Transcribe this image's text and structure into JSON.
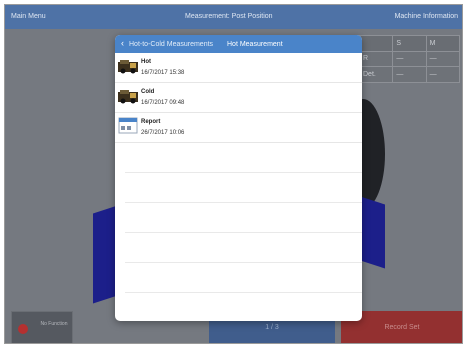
{
  "topbar": {
    "left": "Main Menu",
    "center": "Measurement: Post Position",
    "right": "Machine Information"
  },
  "grid": {
    "header": [
      "",
      "S",
      "M"
    ],
    "rows": [
      [
        "R",
        "—",
        "—"
      ],
      [
        "Det.",
        "—",
        "—"
      ]
    ]
  },
  "bottom": {
    "left_label": "No Function",
    "middle_label": "1 / 3",
    "right_label": "Record Set"
  },
  "dialog": {
    "back_label": "Hot-to-Cold Measurements",
    "title": "Hot Measurement",
    "items": [
      {
        "name": "Hot",
        "date": "16/7/2017 15:38",
        "icon": "vehicle-icon"
      },
      {
        "name": "Cold",
        "date": "16/7/2017 09:48",
        "icon": "vehicle-icon"
      },
      {
        "name": "Report",
        "date": "26/7/2017 10:06",
        "icon": "report-icon"
      }
    ],
    "empty_rows": 5
  }
}
